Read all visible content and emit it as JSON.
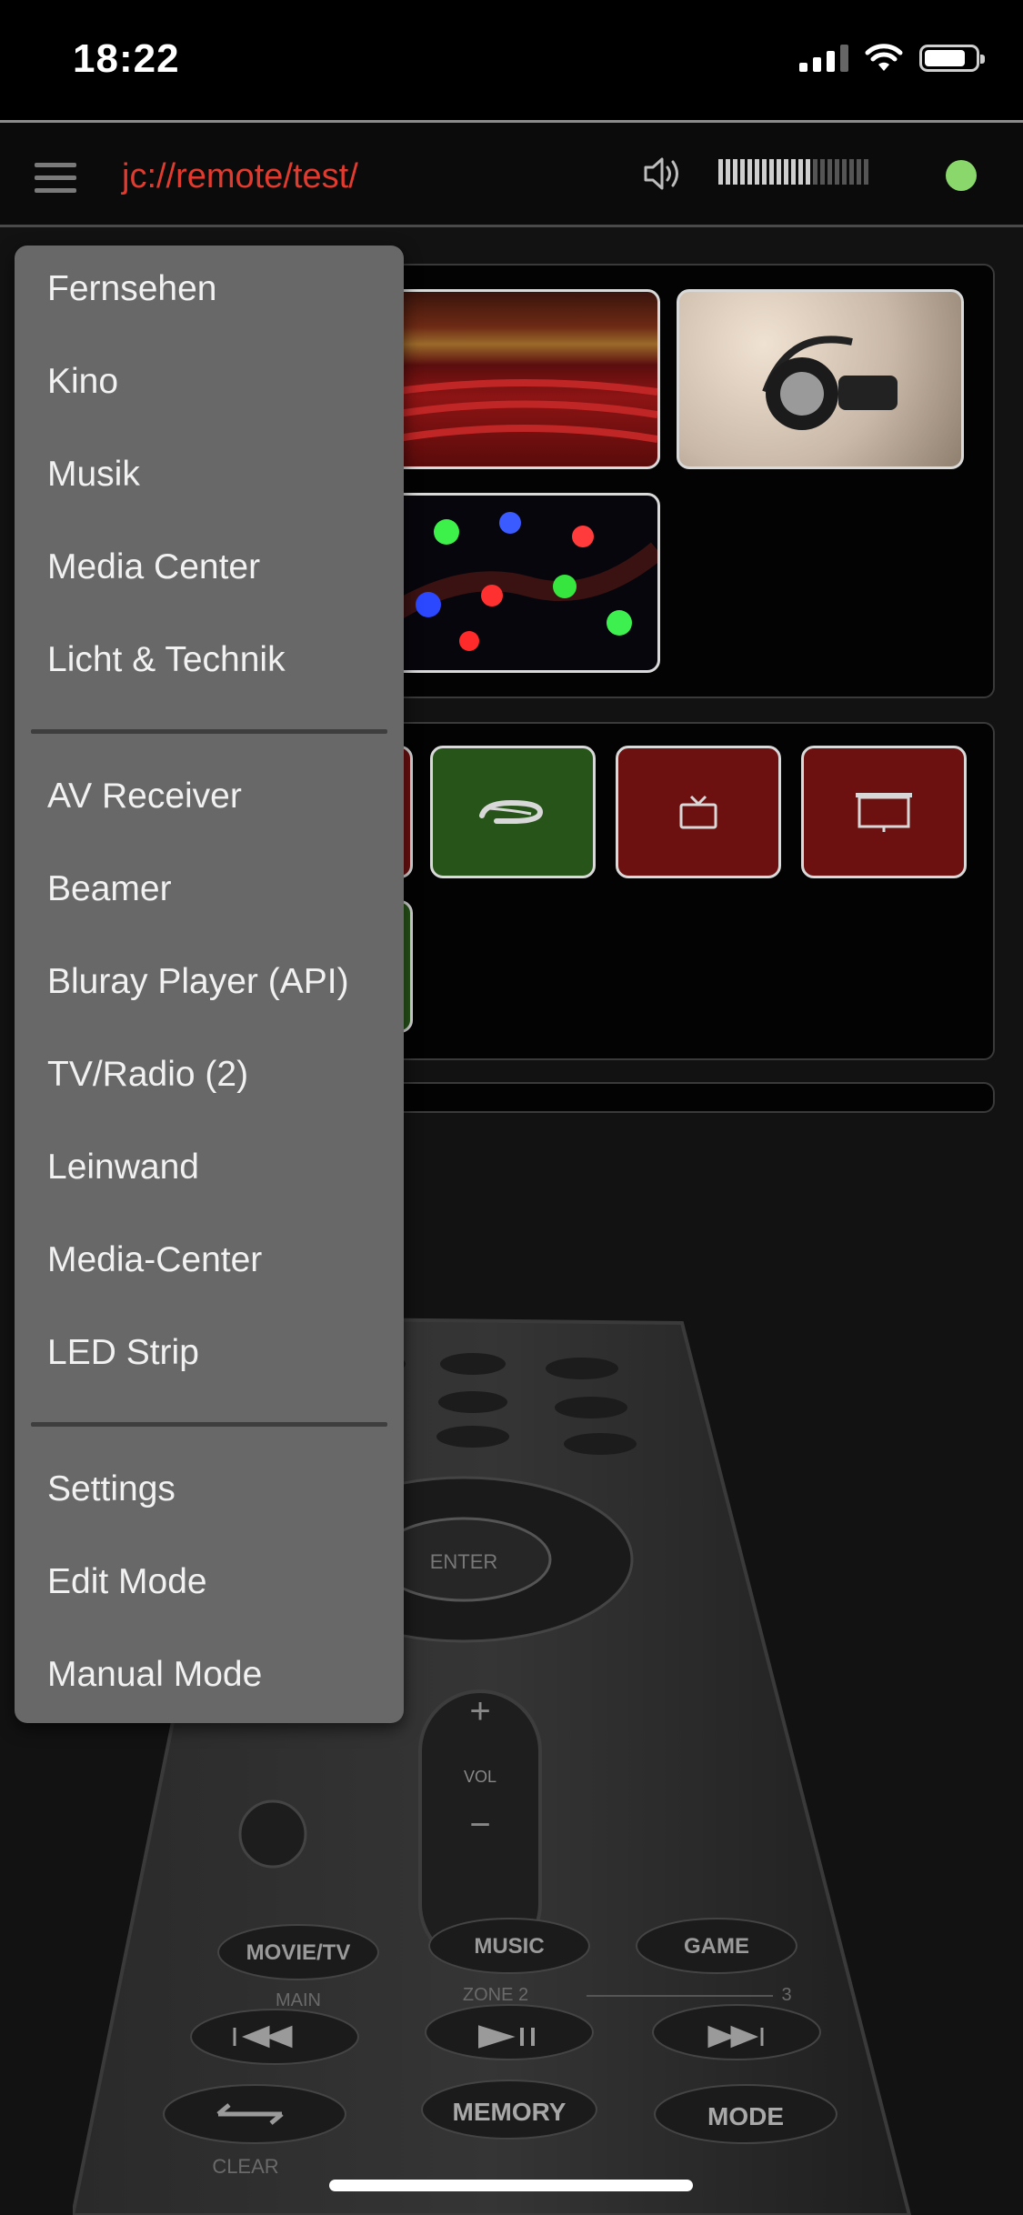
{
  "status_bar": {
    "time": "18:22"
  },
  "header": {
    "title": "jc://remote/test/",
    "volume_level": 0.6,
    "connection_status_color": "#8ad86b"
  },
  "menu": {
    "groups": [
      [
        "Fernsehen",
        "Kino",
        "Musik",
        "Media Center",
        "Licht & Technik"
      ],
      [
        "AV Receiver",
        "Beamer",
        "Bluray Player (API)",
        "TV/Radio (2)",
        "Leinwand",
        "Media-Center",
        "LED Strip"
      ],
      [
        "Settings",
        "Edit Mode",
        "Manual Mode"
      ]
    ]
  },
  "scene_tiles": [
    {
      "icon": "cinema-seats-image"
    },
    {
      "icon": "headphones-image"
    },
    {
      "icon": "led-strip-image"
    }
  ],
  "device_buttons": [
    {
      "icon": "bluray-icon",
      "color": "#275519"
    },
    {
      "icon": "tv-icon",
      "color": "#6c1010"
    },
    {
      "icon": "projector-screen-icon",
      "color": "#6c1010"
    }
  ],
  "remote_labels": {
    "enter": "ENTER",
    "vol_plus": "+",
    "vol": "VOL",
    "vol_minus": "−",
    "movie_tv": "MOVIE/TV",
    "music": "MUSIC",
    "game": "GAME",
    "main": "MAIN",
    "zone2": "ZONE 2",
    "zone3": "3",
    "memory": "MEMORY",
    "mode": "MODE",
    "clear": "CLEAR"
  }
}
